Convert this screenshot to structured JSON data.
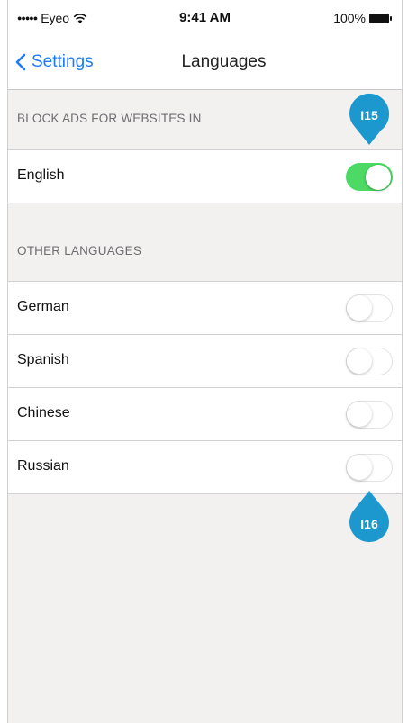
{
  "status_bar": {
    "signal": "●●●●●",
    "carrier": "Eyeo",
    "time": "9:41 AM",
    "battery": "100%"
  },
  "nav": {
    "back_label": "Settings",
    "title": "Languages"
  },
  "sections": [
    {
      "header": "BLOCK ADS FOR WEBSITES IN",
      "rows": [
        {
          "label": "English",
          "enabled": true
        }
      ]
    },
    {
      "header": "OTHER LANGUAGES",
      "rows": [
        {
          "label": "German",
          "enabled": false
        },
        {
          "label": "Spanish",
          "enabled": false
        },
        {
          "label": "Chinese",
          "enabled": false
        },
        {
          "label": "Russian",
          "enabled": false
        }
      ]
    }
  ],
  "annotations": [
    {
      "label": "I15"
    },
    {
      "label": "I16"
    }
  ],
  "colors": {
    "accent": "#1f7bf4",
    "toggle_on": "#4cd964",
    "pin": "#1c98cf"
  }
}
